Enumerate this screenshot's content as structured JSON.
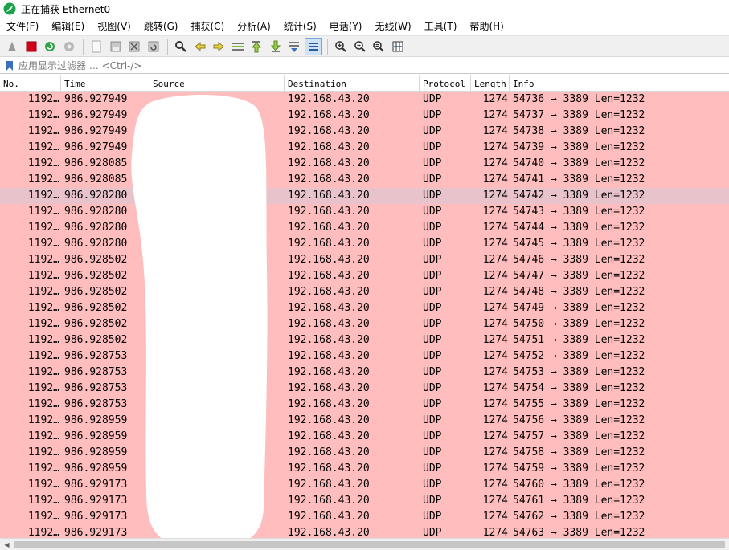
{
  "window": {
    "title": "正在捕获 Ethernet0"
  },
  "menu": [
    "文件(F)",
    "编辑(E)",
    "视图(V)",
    "跳转(G)",
    "捕获(C)",
    "分析(A)",
    "统计(S)",
    "电话(Y)",
    "无线(W)",
    "工具(T)",
    "帮助(H)"
  ],
  "toolbar": {
    "buttons": [
      "start-capture",
      "stop-capture",
      "restart-capture",
      "capture-options",
      "open-file",
      "save-file",
      "close-file",
      "reload-file",
      "find-packet",
      "go-back",
      "go-forward",
      "go-to-packet",
      "go-first",
      "go-last",
      "auto-scroll",
      "colorize",
      "zoom-in",
      "zoom-out",
      "normal-size",
      "resize-columns"
    ]
  },
  "filter": {
    "placeholder": "应用显示过滤器 … <Ctrl-/>"
  },
  "columns": [
    "No.",
    "Time",
    "Source",
    "Destination",
    "Protocol",
    "Length",
    "Info"
  ],
  "packets": [
    {
      "no": "1192…",
      "time": "986.927949",
      "dst": "192.168.43.20",
      "proto": "UDP",
      "len": "1274",
      "info": "54736 → 3389 Len=1232"
    },
    {
      "no": "1192…",
      "time": "986.927949",
      "dst": "192.168.43.20",
      "proto": "UDP",
      "len": "1274",
      "info": "54737 → 3389 Len=1232"
    },
    {
      "no": "1192…",
      "time": "986.927949",
      "dst": "192.168.43.20",
      "proto": "UDP",
      "len": "1274",
      "info": "54738 → 3389 Len=1232"
    },
    {
      "no": "1192…",
      "time": "986.927949",
      "dst": "192.168.43.20",
      "proto": "UDP",
      "len": "1274",
      "info": "54739 → 3389 Len=1232"
    },
    {
      "no": "1192…",
      "time": "986.928085",
      "dst": "192.168.43.20",
      "proto": "UDP",
      "len": "1274",
      "info": "54740 → 3389 Len=1232"
    },
    {
      "no": "1192…",
      "time": "986.928085",
      "dst": "192.168.43.20",
      "proto": "UDP",
      "len": "1274",
      "info": "54741 → 3389 Len=1232"
    },
    {
      "no": "1192…",
      "time": "986.928280",
      "dst": "192.168.43.20",
      "proto": "UDP",
      "len": "1274",
      "info": "54742 → 3389 Len=1232",
      "selected": true
    },
    {
      "no": "1192…",
      "time": "986.928280",
      "dst": "192.168.43.20",
      "proto": "UDP",
      "len": "1274",
      "info": "54743 → 3389 Len=1232"
    },
    {
      "no": "1192…",
      "time": "986.928280",
      "dst": "192.168.43.20",
      "proto": "UDP",
      "len": "1274",
      "info": "54744 → 3389 Len=1232"
    },
    {
      "no": "1192…",
      "time": "986.928280",
      "dst": "192.168.43.20",
      "proto": "UDP",
      "len": "1274",
      "info": "54745 → 3389 Len=1232"
    },
    {
      "no": "1192…",
      "time": "986.928502",
      "dst": "192.168.43.20",
      "proto": "UDP",
      "len": "1274",
      "info": "54746 → 3389 Len=1232"
    },
    {
      "no": "1192…",
      "time": "986.928502",
      "dst": "192.168.43.20",
      "proto": "UDP",
      "len": "1274",
      "info": "54747 → 3389 Len=1232"
    },
    {
      "no": "1192…",
      "time": "986.928502",
      "dst": "192.168.43.20",
      "proto": "UDP",
      "len": "1274",
      "info": "54748 → 3389 Len=1232"
    },
    {
      "no": "1192…",
      "time": "986.928502",
      "dst": "192.168.43.20",
      "proto": "UDP",
      "len": "1274",
      "info": "54749 → 3389 Len=1232"
    },
    {
      "no": "1192…",
      "time": "986.928502",
      "dst": "192.168.43.20",
      "proto": "UDP",
      "len": "1274",
      "info": "54750 → 3389 Len=1232"
    },
    {
      "no": "1192…",
      "time": "986.928502",
      "dst": "192.168.43.20",
      "proto": "UDP",
      "len": "1274",
      "info": "54751 → 3389 Len=1232"
    },
    {
      "no": "1192…",
      "time": "986.928753",
      "dst": "192.168.43.20",
      "proto": "UDP",
      "len": "1274",
      "info": "54752 → 3389 Len=1232"
    },
    {
      "no": "1192…",
      "time": "986.928753",
      "dst": "192.168.43.20",
      "proto": "UDP",
      "len": "1274",
      "info": "54753 → 3389 Len=1232"
    },
    {
      "no": "1192…",
      "time": "986.928753",
      "dst": "192.168.43.20",
      "proto": "UDP",
      "len": "1274",
      "info": "54754 → 3389 Len=1232"
    },
    {
      "no": "1192…",
      "time": "986.928753",
      "dst": "192.168.43.20",
      "proto": "UDP",
      "len": "1274",
      "info": "54755 → 3389 Len=1232"
    },
    {
      "no": "1192…",
      "time": "986.928959",
      "dst": "192.168.43.20",
      "proto": "UDP",
      "len": "1274",
      "info": "54756 → 3389 Len=1232"
    },
    {
      "no": "1192…",
      "time": "986.928959",
      "dst": "192.168.43.20",
      "proto": "UDP",
      "len": "1274",
      "info": "54757 → 3389 Len=1232"
    },
    {
      "no": "1192…",
      "time": "986.928959",
      "dst": "192.168.43.20",
      "proto": "UDP",
      "len": "1274",
      "info": "54758 → 3389 Len=1232"
    },
    {
      "no": "1192…",
      "time": "986.928959",
      "dst": "192.168.43.20",
      "proto": "UDP",
      "len": "1274",
      "info": "54759 → 3389 Len=1232"
    },
    {
      "no": "1192…",
      "time": "986.929173",
      "dst": "192.168.43.20",
      "proto": "UDP",
      "len": "1274",
      "info": "54760 → 3389 Len=1232"
    },
    {
      "no": "1192…",
      "time": "986.929173",
      "dst": "192.168.43.20",
      "proto": "UDP",
      "len": "1274",
      "info": "54761 → 3389 Len=1232"
    },
    {
      "no": "1192…",
      "time": "986.929173",
      "dst": "192.168.43.20",
      "proto": "UDP",
      "len": "1274",
      "info": "54762 → 3389 Len=1232"
    },
    {
      "no": "1192…",
      "time": "986.929173",
      "dst": "192.168.43.20",
      "proto": "UDP",
      "len": "1274",
      "info": "54763 → 3389 Len=1232"
    }
  ],
  "colors": {
    "udp_row": "#ffbdbd",
    "selected_row": "#e8c3cb",
    "redaction": "#ffffff"
  }
}
